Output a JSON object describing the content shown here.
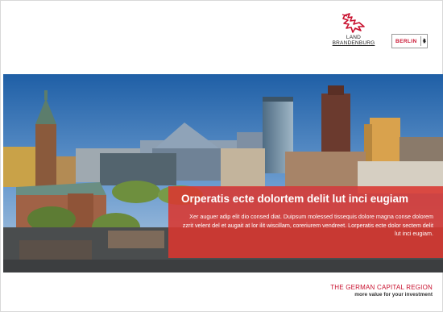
{
  "header": {
    "brandenburg_logo": {
      "line1": "LAND",
      "line2": "BRANDENBURG",
      "icon": "red-eagle-icon"
    },
    "berlin_logo": {
      "label": "BERLIN",
      "icon": "berlin-bear-icon"
    }
  },
  "hero": {
    "photo": "berlin-skyline-photo",
    "headline": "Orperatis ecte dolortem delit lut inci eugiam",
    "body": "Xer auguer adip elit dio consed diat. Duipsum molessed tissequis dolore magna conse dolorem zzrit velent del et augait at lor ilit wiscillam, coreriurem vendreet. Lorperatis ecte dolor sectem delit lut inci eugiam."
  },
  "footer": {
    "tagline": "THE GERMAN CAPITAL REGION",
    "subline": "more value for your investment"
  },
  "colors": {
    "accent_red": "#c8102e",
    "overlay_red": "#da3730"
  }
}
